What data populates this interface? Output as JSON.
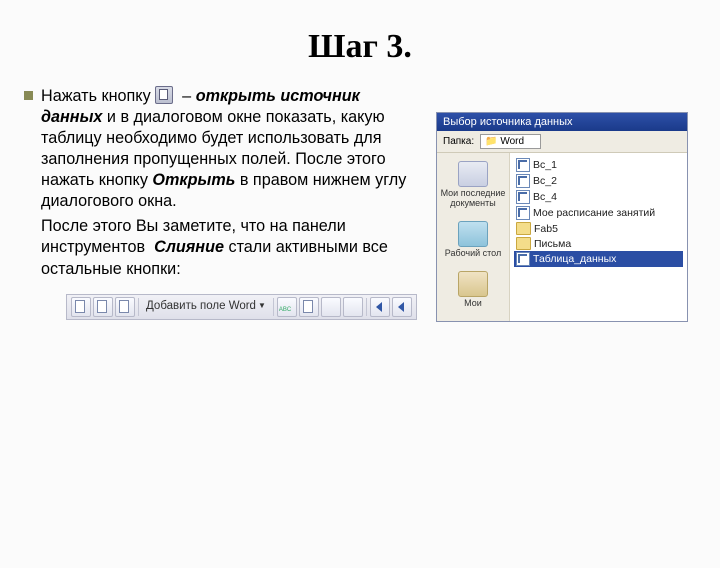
{
  "title": "Шаг 3.",
  "bullet": {
    "lead": "Нажать кнопку",
    "dash": "–",
    "action_bi": "открыть источник данных",
    "cont1": " и в диалоговом окне показать, какую таблицу необходимо будет использовать для заполнения пропущенных полей. После этого нажать кнопку ",
    "open_bi": "Открыть",
    "cont2": " в правом нижнем углу диалогового окна."
  },
  "para2": {
    "lead": "После этого Вы заметите, что на панели инструментов ",
    "merge_bi": "Слияние",
    "tail": " стали активными все остальные кнопки:"
  },
  "dialog": {
    "title": "Выбор источника данных",
    "folder_label": "Папка:",
    "folder_value": "Word",
    "places": [
      "Мои последние документы",
      "Рабочий стол",
      "Мои"
    ],
    "files_doc": [
      "Вс_1",
      "Вс_2",
      "Вс_4",
      "Мое расписание занятий"
    ],
    "files_folder": [
      "Fab5",
      "Письма"
    ],
    "file_selected": "Таблица_данных"
  },
  "toolbar": {
    "add_word_label": "Добавить поле Word",
    "abc": "ABC"
  }
}
